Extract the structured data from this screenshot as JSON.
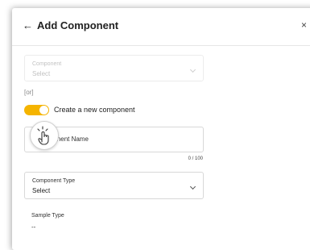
{
  "header": {
    "back_icon": "arrow-left-icon",
    "title": "Add Component",
    "close_icon": "close-icon",
    "back_glyph": "←",
    "close_glyph": "×"
  },
  "component_select": {
    "label": "Component",
    "value": "Select",
    "disabled": true
  },
  "or_text": "[or]",
  "create_toggle": {
    "label": "Create a new component",
    "on": true,
    "color": "#f5b400"
  },
  "name_input": {
    "placeholder": "Component Name",
    "counter": "0 / 100"
  },
  "component_type": {
    "label": "Component Type",
    "value": "Select"
  },
  "sample_type": {
    "label": "Sample Type",
    "value": "--"
  }
}
